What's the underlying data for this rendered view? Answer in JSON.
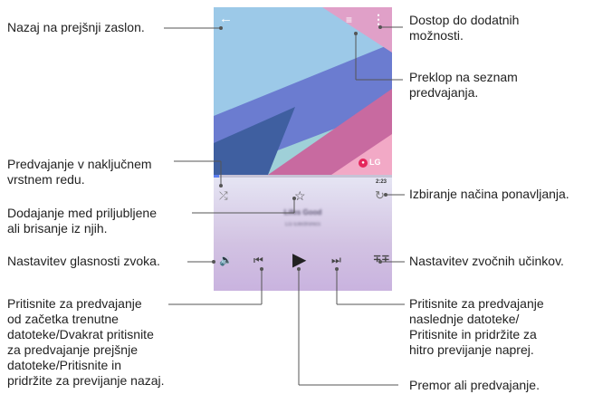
{
  "player": {
    "time": "2:23",
    "song_title": "Lifes Good",
    "song_artist": "LG Electronics",
    "logo_text": "LG",
    "icons": {
      "back": "arrow-left-icon",
      "playlist": "playlist-icon",
      "more": "more-vertical-icon",
      "shuffle": "shuffle-icon",
      "favorite": "star-icon",
      "repeat": "repeat-icon",
      "volume": "speaker-icon",
      "previous": "skip-previous-icon",
      "play": "play-icon",
      "next": "skip-next-icon",
      "effects": "equalizer-icon"
    },
    "colors": {
      "progress": "#5c7ef0",
      "logo_badge": "#e5265c"
    }
  },
  "callouts": {
    "back": "Nazaj na prejšnji zaslon.",
    "more_options": [
      "Dostop do dodatnih",
      "možnosti."
    ],
    "playlist": [
      "Preklop na seznam",
      "predvajanja."
    ],
    "shuffle": [
      "Predvajanje v naključnem",
      "vrstnem redu."
    ],
    "repeat": "Izbiranje načina ponavljanja.",
    "favorites": [
      "Dodajanje med priljubljene",
      "ali brisanje iz njih."
    ],
    "volume": "Nastavitev glasnosti zvoka.",
    "effects": "Nastavitev zvočnih učinkov.",
    "previous": [
      "Pritisnite za predvajanje",
      "od začetka trenutne",
      "datoteke/Dvakrat pritisnite",
      "za predvajanje prejšnje",
      "datoteke/Pritisnite in",
      "pridržite za previjanje nazaj."
    ],
    "next": [
      "Pritisnite za predvajanje",
      "naslednje datoteke/",
      "Pritisnite in pridržite za",
      "hitro previjanje naprej."
    ],
    "play_pause": "Premor ali predvajanje."
  }
}
